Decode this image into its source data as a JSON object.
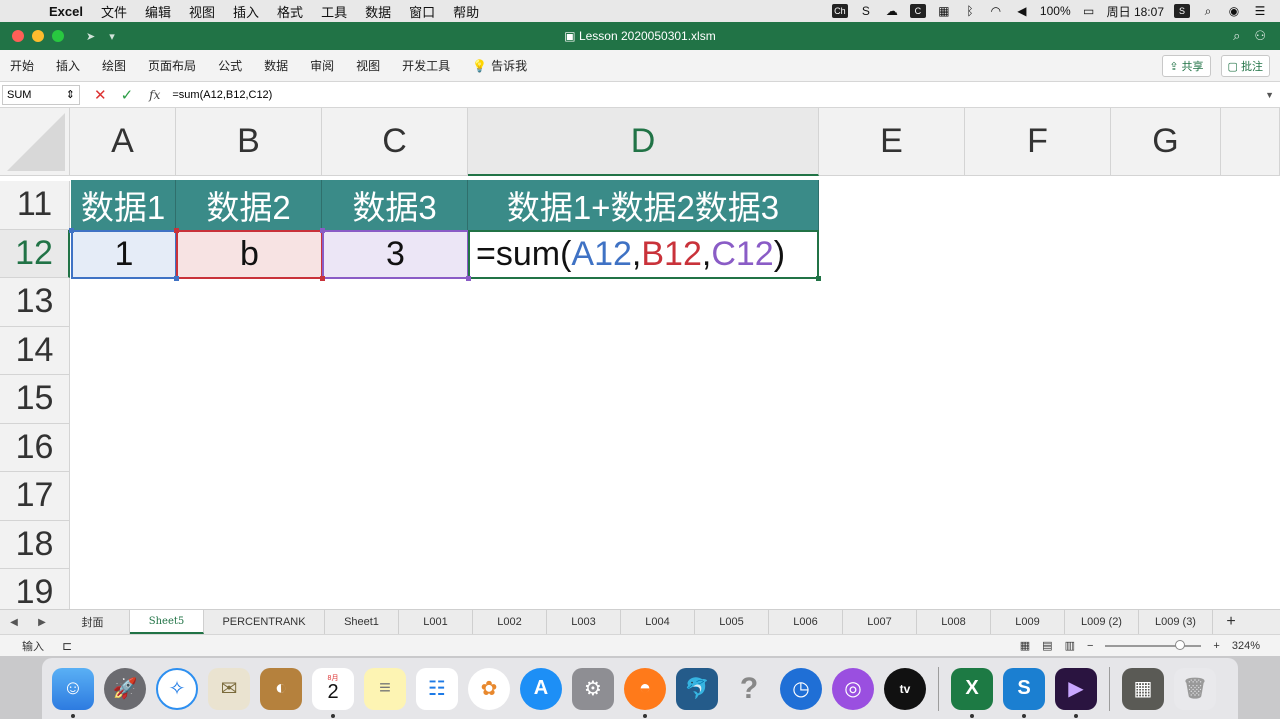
{
  "menubar": {
    "apple": "",
    "app_name": "Excel",
    "items": [
      "文件",
      "编辑",
      "视图",
      "插入",
      "格式",
      "工具",
      "数据",
      "窗口",
      "帮助"
    ],
    "battery": "100%",
    "clock": "周日 18:07"
  },
  "window": {
    "title": "Lesson 2020050301.xlsm"
  },
  "ribbon": {
    "tabs": [
      "开始",
      "插入",
      "绘图",
      "页面布局",
      "公式",
      "数据",
      "审阅",
      "视图",
      "开发工具"
    ],
    "tell_me": "告诉我",
    "share": "共享",
    "comments": "批注"
  },
  "formula_bar": {
    "name_box": "SUM",
    "fx": "fx",
    "formula": "=sum(A12,B12,C12)"
  },
  "grid": {
    "columns": [
      "A",
      "B",
      "C",
      "D",
      "E",
      "F",
      "G"
    ],
    "selected_column": "D",
    "rows": [
      "11",
      "12",
      "13",
      "14",
      "15",
      "16",
      "17",
      "18",
      "19"
    ],
    "selected_row": "12",
    "header_row": [
      "数据1",
      "数据2",
      "数据3",
      "数据1+数据2数据3"
    ],
    "data_row": {
      "a": "1",
      "b": "b",
      "c": "3",
      "formula_prefix": "=sum(",
      "ref_a": "A12",
      "comma1": ",",
      "ref_b": "B12",
      "comma2": ",",
      "ref_c": "C12",
      "formula_suffix": ")"
    }
  },
  "sheet_tabs": {
    "tabs": [
      "封面",
      "Sheet5",
      "PERCENTRANK",
      "Sheet1",
      "L001",
      "L002",
      "L003",
      "L004",
      "L005",
      "L006",
      "L007",
      "L008",
      "L009",
      "L009 (2)",
      "L009 (3)"
    ],
    "active": "Sheet5",
    "add": "+"
  },
  "status": {
    "mode": "输入",
    "zoom": "324%",
    "zoom_level": 0.78,
    "minus": "−",
    "plus": "+"
  },
  "dock": {
    "apps": [
      "finder-icon",
      "launchpad-icon",
      "safari-icon",
      "mail-icon",
      "contacts-icon",
      "calendar-icon",
      "notes-icon",
      "reminders-icon",
      "photos-icon",
      "app-store-icon",
      "system-preferences-icon",
      "firefox-icon",
      "mysql-workbench-icon",
      "help-icon",
      "time-icon",
      "podcasts-icon",
      "apple-tv-icon",
      "excel-icon",
      "snagit-icon",
      "premiere-icon",
      "screenshot-icon",
      "trash-icon"
    ],
    "calendar_month": "8月",
    "calendar_day": "2",
    "tv_label": "tv"
  }
}
